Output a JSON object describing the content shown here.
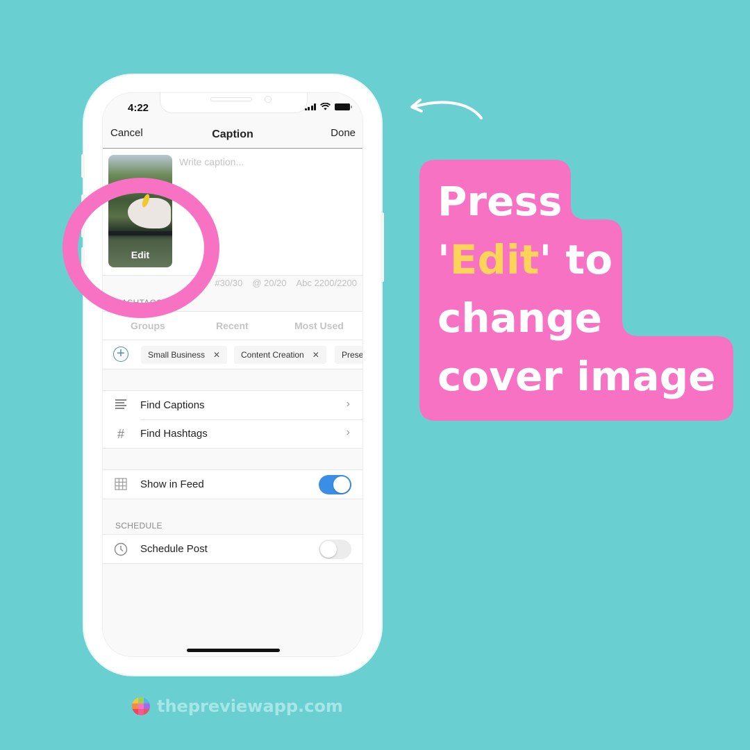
{
  "status_bar": {
    "time": "4:22"
  },
  "navbar": {
    "cancel_label": "Cancel",
    "title": "Caption",
    "done_label": "Done"
  },
  "caption": {
    "placeholder": "Write caption...",
    "thumbnail_edit_label": "Edit",
    "counters": [
      "#30/30",
      "@ 20/20",
      "Abc 2200/2200"
    ]
  },
  "hashtags": {
    "section_label": "HASHTAGS",
    "tabs": [
      "Groups",
      "Recent",
      "Most Used"
    ],
    "chips": [
      {
        "label": "Small Business"
      },
      {
        "label": "Content Creation"
      },
      {
        "label": "Preset"
      }
    ],
    "add_icon": "plus-circle-icon"
  },
  "tools": [
    {
      "icon": "lines-icon",
      "label": "Find Captions"
    },
    {
      "icon": "hash-icon",
      "label": "Find Hashtags"
    }
  ],
  "feed": {
    "icon": "grid-icon",
    "label": "Show in Feed",
    "enabled": true
  },
  "schedule": {
    "section_label": "SCHEDULE",
    "icon": "clock-icon",
    "label": "Schedule Post",
    "enabled": false
  },
  "callout": {
    "line1": "Press",
    "line2_quote_open": "'",
    "line2_highlight": "Edit",
    "line2_rest": "' to",
    "line3": "change",
    "line4": "cover image"
  },
  "brand": {
    "text": "thepreviewapp.com"
  },
  "colors": {
    "background": "#6acfd1",
    "callout_pink": "#f872c4",
    "highlight_yellow": "#fdd35a",
    "toggle_blue": "#3b8ee6"
  }
}
